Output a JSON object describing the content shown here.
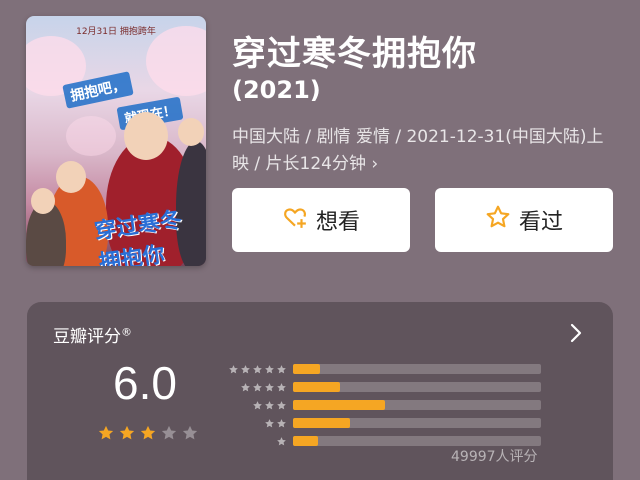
{
  "poster": {
    "date_banner": "12月31日 拥抱跨年",
    "slogan_line1": "拥抱吧，",
    "slogan_line2": "就现在！",
    "title_art": "穿过寒冬 拥抱你"
  },
  "movie": {
    "title": "穿过寒冬拥抱你",
    "year": "(2021)",
    "meta": "中国大陆 / 剧情 爱情 / 2021-12-31(中国大陆)上映 / 片长124分钟 ›"
  },
  "actions": {
    "want_label": "想看",
    "watched_label": "看过"
  },
  "rating": {
    "label": "豆瓣评分",
    "registered": "®",
    "score": "6.0",
    "stars_filled": 3,
    "stars_total": 5,
    "distribution": [
      {
        "stars": 5,
        "percent": 11
      },
      {
        "stars": 4,
        "percent": 19
      },
      {
        "stars": 3,
        "percent": 37
      },
      {
        "stars": 2,
        "percent": 23
      },
      {
        "stars": 1,
        "percent": 10
      }
    ],
    "votes": "49997人评分"
  },
  "colors": {
    "background": "#7f707a",
    "accent": "#f5a623"
  }
}
